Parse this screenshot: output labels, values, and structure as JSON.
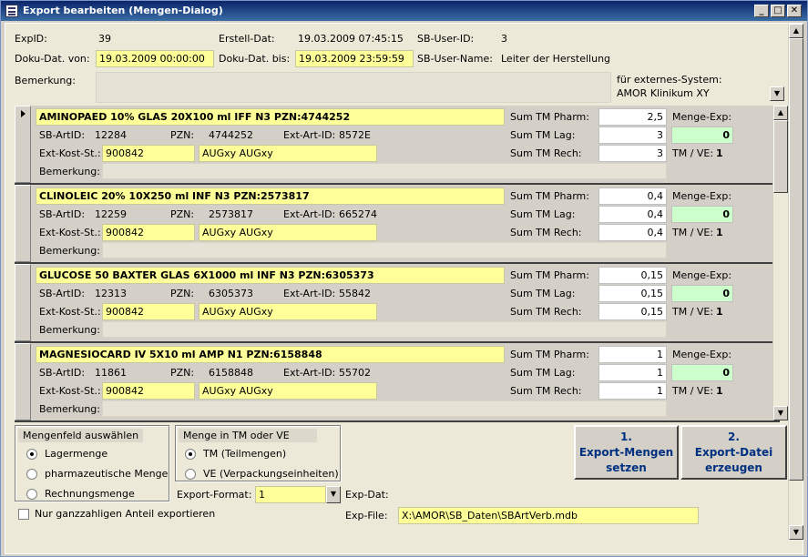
{
  "window": {
    "title": "Export bearbeiten (Mengen-Dialog)",
    "min_glyph": "_",
    "max_glyph": "□",
    "close_glyph": "✕"
  },
  "header": {
    "expid_label": "ExpID:",
    "expid_value": "39",
    "erstell_label": "Erstell-Dat:",
    "erstell_value": "19.03.2009 07:45:15",
    "sbuser_label": "SB-User-ID:",
    "sbuser_value": "3",
    "doku_von_label": "Doku-Dat. von:",
    "doku_von_value": "19.03.2009 00:00:00",
    "doku_bis_label": "Doku-Dat. bis:",
    "doku_bis_value": "19.03.2009 23:59:59",
    "sbusername_label": "SB-User-Name:",
    "sbusername_value": "Leiter der Herstellung",
    "bemerkung_label": "Bemerkung:",
    "extsys_label": "für externes-System:",
    "extsys_value": "AMOR Klinikum XY"
  },
  "labels": {
    "sb_artid": "SB-ArtID:",
    "pzn": "PZN:",
    "ext_art_id": "Ext-Art-ID:",
    "ext_kost": "Ext-Kost-St.:",
    "bemerkung": "Bemerkung:",
    "sum_pharm": "Sum TM Pharm:",
    "sum_lag": "Sum TM Lag:",
    "sum_rech": "Sum TM Rech:",
    "menge_exp": "Menge-Exp:",
    "tm_ve": "TM / VE:"
  },
  "records": [
    {
      "title": "AMINOPAED 10% GLAS   20X100 ml IFF N3 PZN:4744252",
      "sb_artid": "12284",
      "pzn": "4744252",
      "ext_art_id": "8572E",
      "kost": "900842",
      "kost_text": "AUGxy    AUGxy",
      "sum_pharm": "2,5",
      "sum_lag": "3",
      "sum_rech": "3",
      "menge_exp": "0",
      "tm_ve": "1"
    },
    {
      "title": "CLINOLEIC 20%   10X250 ml INF N3 PZN:2573817",
      "sb_artid": "12259",
      "pzn": "2573817",
      "ext_art_id": "665274",
      "kost": "900842",
      "kost_text": "AUGxy    AUGxy",
      "sum_pharm": "0,4",
      "sum_lag": "0,4",
      "sum_rech": "0,4",
      "menge_exp": "0",
      "tm_ve": "1"
    },
    {
      "title": "GLUCOSE 50 BAXTER GLAS   6X1000 ml INF N3 PZN:6305373",
      "sb_artid": "12313",
      "pzn": "6305373",
      "ext_art_id": "55842",
      "kost": "900842",
      "kost_text": "AUGxy    AUGxy",
      "sum_pharm": "0,15",
      "sum_lag": "0,15",
      "sum_rech": "0,15",
      "menge_exp": "0",
      "tm_ve": "1"
    },
    {
      "title": "MAGNESIOCARD IV   5X10 ml AMP N1 PZN:6158848",
      "sb_artid": "11861",
      "pzn": "6158848",
      "ext_art_id": "55702",
      "kost": "900842",
      "kost_text": "AUGxy    AUGxy",
      "sum_pharm": "1",
      "sum_lag": "1",
      "sum_rech": "1",
      "menge_exp": "0",
      "tm_ve": "1"
    }
  ],
  "footer": {
    "mengenfeld_title": "Mengenfeld auswählen",
    "opt_lager": "Lagermenge",
    "opt_pharm": "pharmazeutische Menge",
    "opt_rech": "Rechnungsmenge",
    "menge_title": "Menge in TM oder VE",
    "opt_tm": "TM (Teilmengen)",
    "opt_ve": "VE (Verpackungseinheiten)",
    "format_label": "Export-Format:",
    "format_value": "1",
    "expdat_label": "Exp-Dat:",
    "expfile_label": "Exp-File:",
    "expfile_value": "X:\\AMOR\\SB_Daten\\SBArtVerb.mdb",
    "checkbox_label": "Nur ganzzahligen Anteil exportieren",
    "btn1": "1.\nExport-Mengen\nsetzen",
    "btn2": "2.\nExport-Datei\nerzeugen"
  },
  "colors": {
    "titlebar": "#0a246a",
    "yellow_field": "#ffff99",
    "green_field": "#ccffcc",
    "button_text": "#003080"
  }
}
